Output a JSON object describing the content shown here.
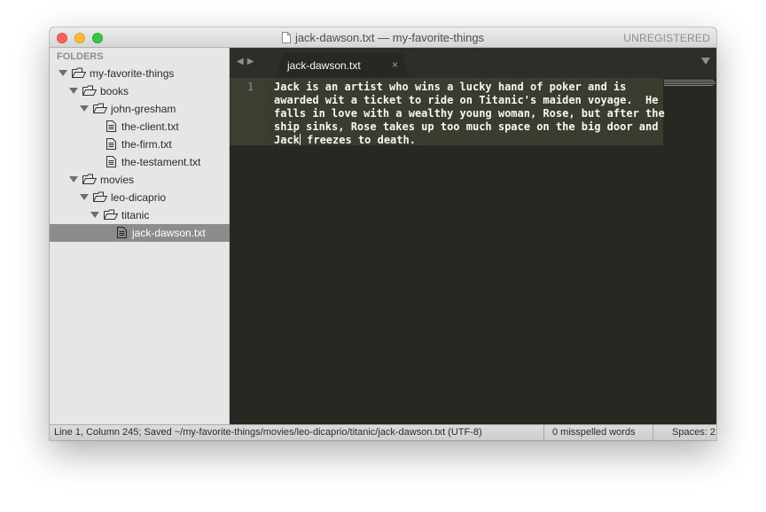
{
  "window": {
    "title": "jack-dawson.txt — my-favorite-things",
    "license_label": "UNREGISTERED"
  },
  "sidebar": {
    "header": "FOLDERS",
    "tree": [
      {
        "label": "my-favorite-things",
        "type": "folder",
        "depth": 0
      },
      {
        "label": "books",
        "type": "folder",
        "depth": 1
      },
      {
        "label": "john-gresham",
        "type": "folder",
        "depth": 2
      },
      {
        "label": "the-client.txt",
        "type": "file",
        "depth": 3
      },
      {
        "label": "the-firm.txt",
        "type": "file",
        "depth": 3
      },
      {
        "label": "the-testament.txt",
        "type": "file",
        "depth": 3
      },
      {
        "label": "movies",
        "type": "folder",
        "depth": 1
      },
      {
        "label": "leo-dicaprio",
        "type": "folder",
        "depth": 2
      },
      {
        "label": "titanic",
        "type": "folder",
        "depth": 3
      },
      {
        "label": "jack-dawson.txt",
        "type": "file",
        "depth": 4,
        "selected": true
      }
    ]
  },
  "tabs": [
    {
      "label": "jack-dawson.txt",
      "close_glyph": "×",
      "active": true
    }
  ],
  "nav": {
    "back_glyph": "◀",
    "forward_glyph": "▶"
  },
  "editor": {
    "line_number": "1",
    "lines": [
      "Jack is an artist who wins a lucky hand of poker and is",
      "awarded wit a ticket to ride on Titanic's maiden voyage.  He",
      "falls in love with a wealthy young woman, Rose, but after the",
      "ship sinks, Rose takes up too much space on the big door and"
    ],
    "last_line_before_cursor": "Jack",
    "last_line_after_cursor": " freezes to death."
  },
  "statusbar": {
    "position": "Line 1, Column 245; Saved ~/my-favorite-things/movies/leo-dicaprio/titanic/jack-dawson.txt (UTF-8)",
    "spelling": "0 misspelled words",
    "indent": "Spaces: 2"
  },
  "colors": {
    "editor_bg": "#272822",
    "editor_fg": "#f8f8f2",
    "sidebar_bg": "#e6e6e6",
    "selection_bg": "#8c8c8c",
    "close": "#fc605c",
    "minimize": "#fdbc40",
    "maximize": "#34c84a"
  }
}
